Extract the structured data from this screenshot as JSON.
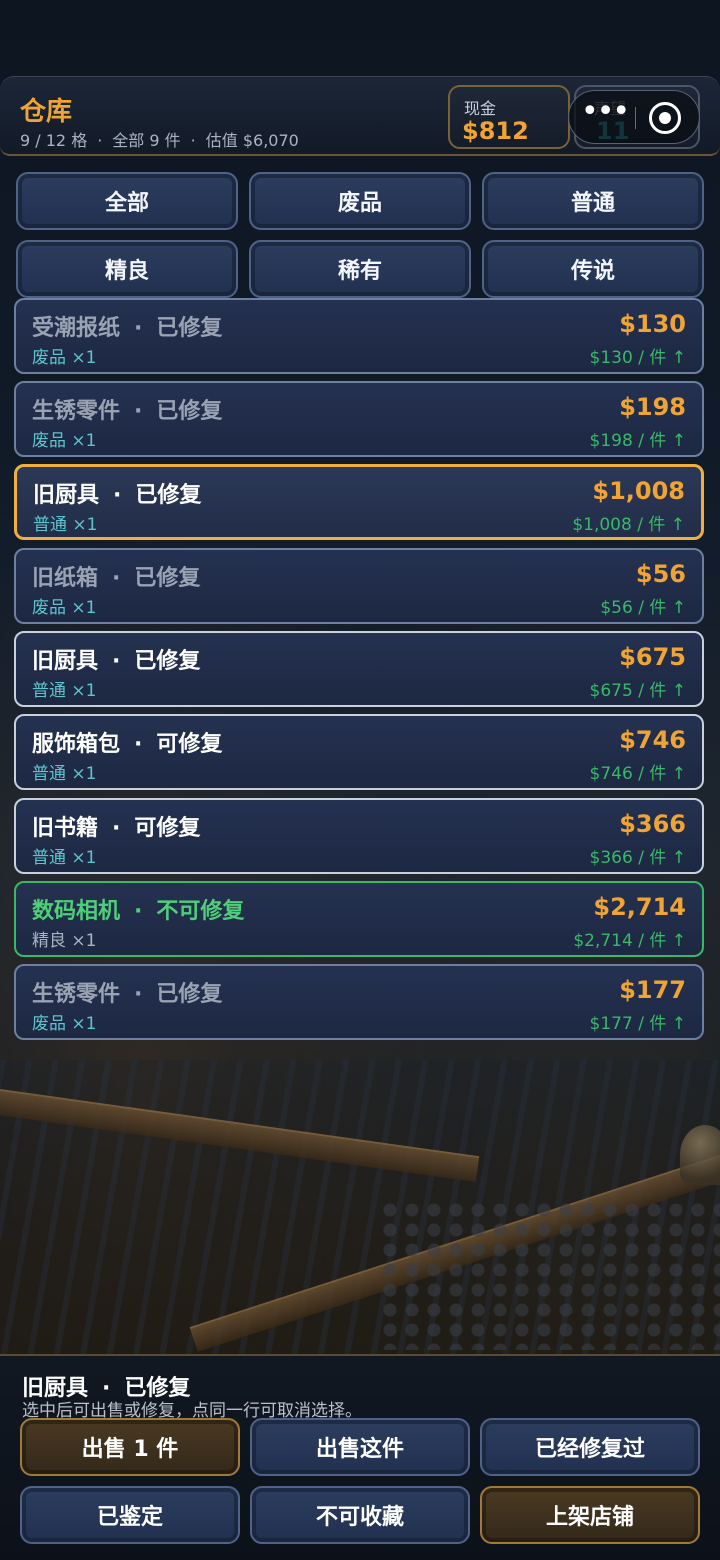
{
  "header": {
    "title": "仓库",
    "slots": "9 / 12 格",
    "total_items": "全部 9 件",
    "estimate": "估值 $6,070",
    "dot": "·",
    "cash_label": "现金",
    "cash_value": "$812",
    "rep_label": "声望",
    "rep_value": "11"
  },
  "capsule": {
    "more_icon": "•••",
    "close_icon": "target-icon"
  },
  "filters": [
    "全部",
    "废品",
    "普通",
    "精良",
    "稀有",
    "传说"
  ],
  "items": [
    {
      "name": "受潮报纸",
      "status": "已修复",
      "grade": "废品",
      "qty": "×1",
      "price": "$130",
      "unit": "$130 / 件 ↑"
    },
    {
      "name": "生锈零件",
      "status": "已修复",
      "grade": "废品",
      "qty": "×1",
      "price": "$198",
      "unit": "$198 / 件 ↑"
    },
    {
      "name": "旧厨具",
      "status": "已修复",
      "grade": "普通",
      "qty": "×1",
      "price": "$1,008",
      "unit": "$1,008 / 件 ↑"
    },
    {
      "name": "旧纸箱",
      "status": "已修复",
      "grade": "废品",
      "qty": "×1",
      "price": "$56",
      "unit": "$56 / 件 ↑"
    },
    {
      "name": "旧厨具",
      "status": "已修复",
      "grade": "普通",
      "qty": "×1",
      "price": "$675",
      "unit": "$675 / 件 ↑"
    },
    {
      "name": "服饰箱包",
      "status": "可修复",
      "grade": "普通",
      "qty": "×1",
      "price": "$746",
      "unit": "$746 / 件 ↑"
    },
    {
      "name": "旧书籍",
      "status": "可修复",
      "grade": "普通",
      "qty": "×1",
      "price": "$366",
      "unit": "$366 / 件 ↑"
    },
    {
      "name": "数码相机",
      "status": "不可修复",
      "grade": "精良",
      "qty": "×1",
      "price": "$2,714",
      "unit": "$2,714 / 件 ↑"
    },
    {
      "name": "生锈零件",
      "status": "已修复",
      "grade": "废品",
      "qty": "×1",
      "price": "$177",
      "unit": "$177 / 件 ↑"
    }
  ],
  "selection": {
    "name": "旧厨具",
    "status": "已修复",
    "hint": "选中后可出售或修复，点同一行可取消选择。"
  },
  "actions": [
    "出售 1 件",
    "出售这件",
    "已经修复过",
    "已鉴定",
    "不可收藏",
    "上架店铺"
  ],
  "colors": {
    "accent": "#f0a434",
    "selected_border": "#f0b040",
    "fine": "#39b86a",
    "teal": "#2aa9b8"
  }
}
